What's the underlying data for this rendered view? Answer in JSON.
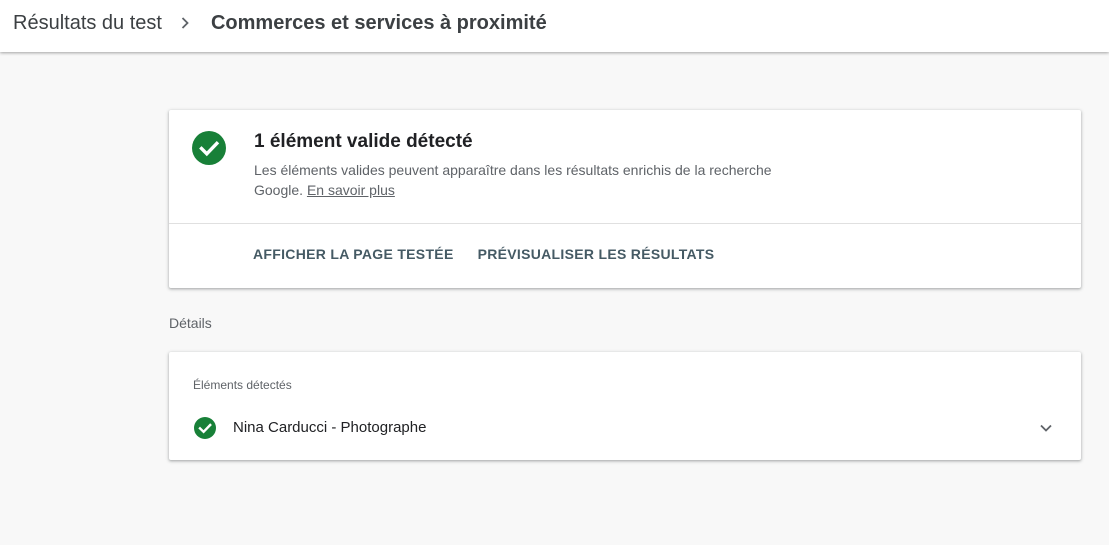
{
  "breadcrumb": {
    "parent_label": "Résultats du test",
    "current_label": "Commerces et services à proximité"
  },
  "summary": {
    "title": "1 élément valide détecté",
    "description": "Les éléments valides peuvent apparaître dans les résultats enrichis de la recherche Google.",
    "learn_more_label": "En savoir plus",
    "actions": {
      "view_page_label": "AFFICHER LA PAGE TESTÉE",
      "preview_results_label": "PRÉVISUALISER LES RÉSULTATS"
    }
  },
  "details": {
    "section_label": "Détails",
    "heading": "Éléments détectés",
    "items": [
      {
        "name": "Nina Carducci - Photographe",
        "status_icon": "check-circle-icon"
      }
    ]
  },
  "colors": {
    "valid_green": "#188038",
    "action_text": "#455a64",
    "background": "#f8f8f8"
  }
}
